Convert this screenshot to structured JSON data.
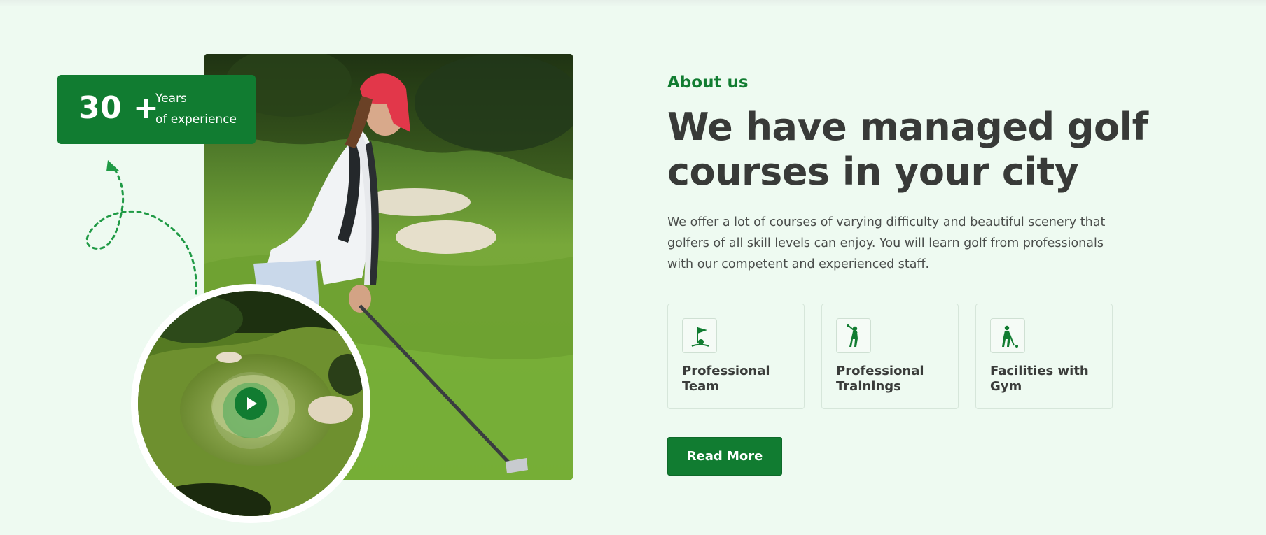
{
  "colors": {
    "brand_green": "#117c31",
    "background": "#eefaf1",
    "heading": "#383a38"
  },
  "experience": {
    "number": "30 +",
    "line1": "Years",
    "line2": "of experience"
  },
  "about": {
    "eyebrow": "About us",
    "headline": "We have managed golf courses in your city",
    "description": "We offer a lot of courses of varying difficulty and beautiful scenery that golfers of all skill levels can enjoy. You will learn golf from professionals with our competent and experienced staff."
  },
  "features": [
    {
      "label": "Professional Team",
      "icon": "golf-flag-icon"
    },
    {
      "label": "Professional Trainings",
      "icon": "golfer-swing-icon"
    },
    {
      "label": "Facilities with Gym",
      "icon": "golfer-putting-icon"
    }
  ],
  "cta": {
    "read_more": "Read More"
  },
  "media": {
    "video_icon": "play-icon"
  }
}
